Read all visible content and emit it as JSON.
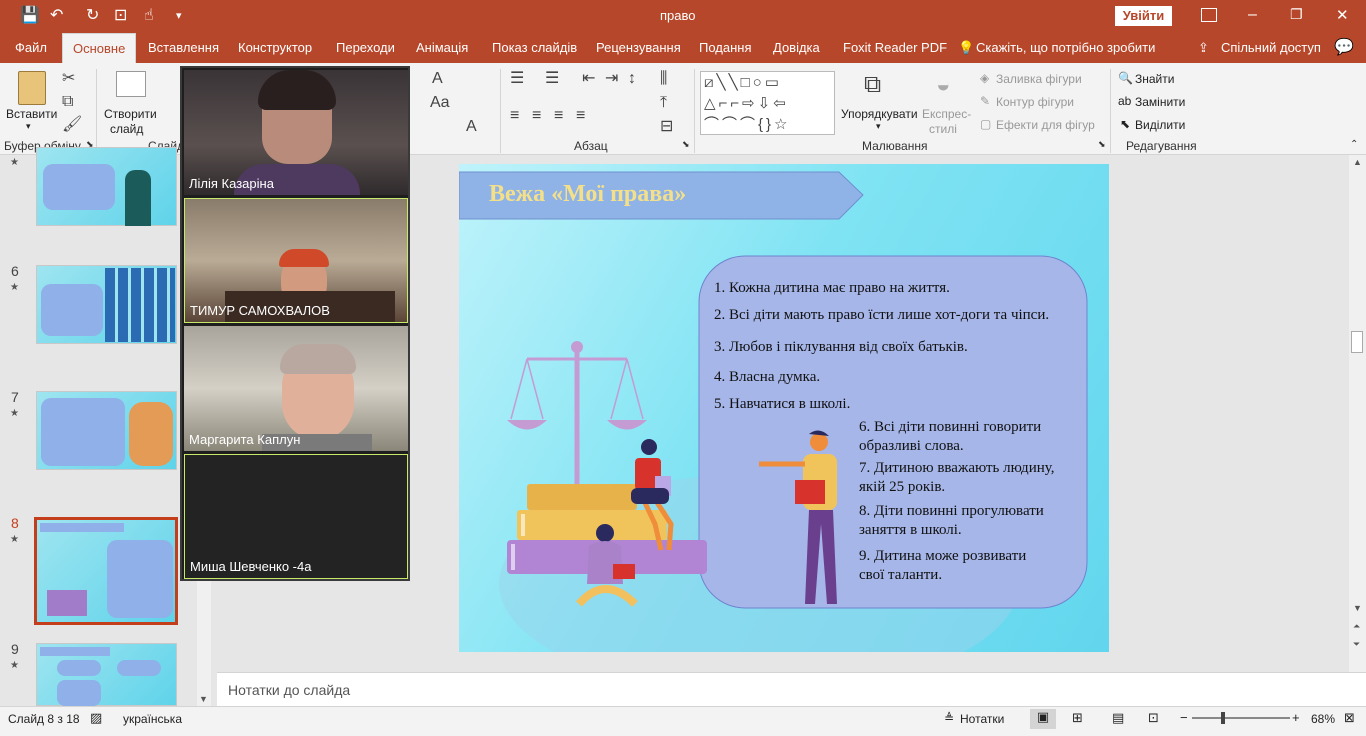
{
  "titlebar": {
    "doc_title": "право",
    "signin": "Увійти",
    "minimize": "–",
    "restore": "❐",
    "close": "✕"
  },
  "tabs": [
    "Файл",
    "Основне",
    "Вставлення",
    "Конструктор",
    "Переходи",
    "Анімація",
    "Показ слайдів",
    "Рецензування",
    "Подання",
    "Довідка",
    "Foxit Reader PDF"
  ],
  "tellme": "Скажіть, що потрібно зробити",
  "share": "Спільний доступ",
  "ribbon": {
    "paste": "Вставити",
    "new_slide_1": "Створити",
    "new_slide_2": "слайд",
    "clipboard_group": "Буфер обміну",
    "slides_group": "Слайди",
    "paragraph_group": "Абзац",
    "drawing_group": "Малювання",
    "editing_group": "Редагування",
    "arrange": "Упорядкувати",
    "quick_styles_1": "Експрес-",
    "quick_styles_2": "стилі",
    "shape_fill": "Заливка фігури",
    "shape_outline": "Контур фігури",
    "shape_effects": "Ефекти для фігур",
    "find": "Знайти",
    "replace": "Замінити",
    "select": "Виділити"
  },
  "thumbnails": [
    {
      "num": "",
      "star": "★"
    },
    {
      "num": "6",
      "star": "★"
    },
    {
      "num": "7",
      "star": "★"
    },
    {
      "num": "8",
      "star": "★"
    },
    {
      "num": "9",
      "star": "★"
    }
  ],
  "slide": {
    "title": "Вежа «Мої права»",
    "rights": [
      "1. Кожна дитина має право на життя.",
      "2. Всі діти мають право їсти лише хот-доги та чіпси.",
      "3. Любов і піклування від своїх батьків.",
      "4. Власна думка.",
      "5. Навчатися в школі."
    ],
    "rights2": [
      "6. Всі діти повинні говорити",
      "образливі слова.",
      "7. Дитиною вважають людину,",
      "якій 25 років.",
      "8. Діти повинні прогулювати",
      "заняття в школі.",
      "9. Дитина може розвивати",
      "свої таланти."
    ]
  },
  "notes_placeholder": "Нотатки до слайда",
  "status": {
    "slide_info": "Слайд 8 з 18",
    "language": "українська",
    "notes_btn": "Нотатки",
    "zoom": "68%"
  },
  "participants": [
    {
      "name": "Лілія Казаріна"
    },
    {
      "name": "ТИМУР   САМОХВАЛОВ"
    },
    {
      "name": "Маргарита Каплун"
    },
    {
      "name": "Миша Шевченко -4а"
    }
  ],
  "colors": {
    "accent": "#b7472a",
    "slide_title": "#f5e08a"
  }
}
